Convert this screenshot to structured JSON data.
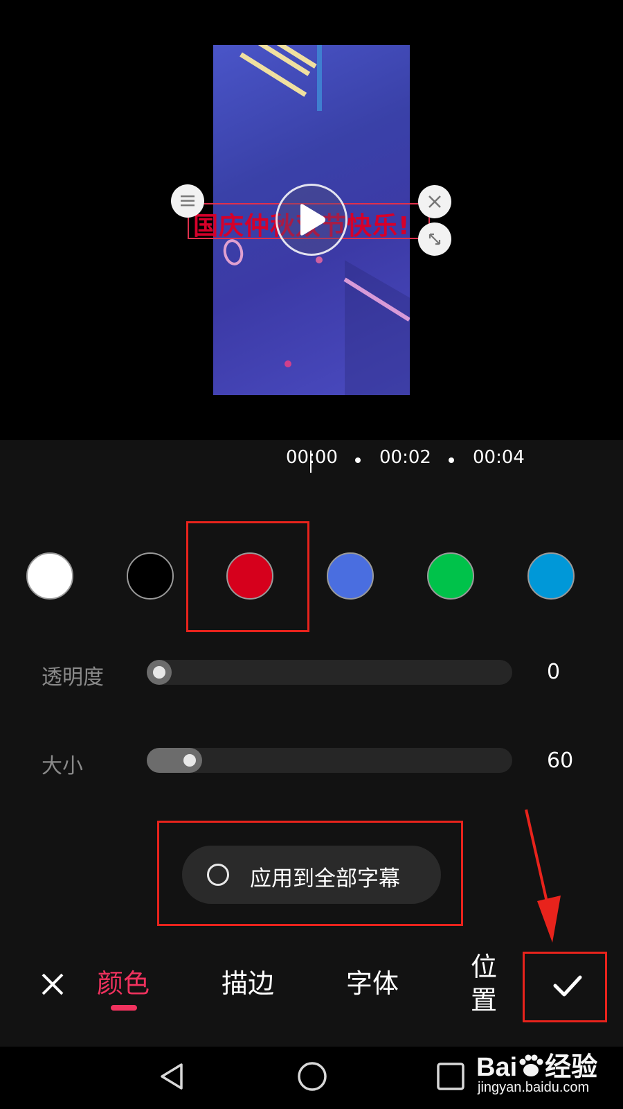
{
  "preview": {
    "subtitle_text": "国庆仲秋双节快乐!"
  },
  "timeline": {
    "current": "00:00",
    "mark_1": "00:02",
    "mark_2": "00:04"
  },
  "colors": {
    "swatches": [
      {
        "name": "white",
        "hex": "#ffffff"
      },
      {
        "name": "black",
        "hex": "#000000"
      },
      {
        "name": "red",
        "hex": "#d6001c",
        "selected": true
      },
      {
        "name": "blue",
        "hex": "#4a6ee0"
      },
      {
        "name": "green",
        "hex": "#00c24a"
      },
      {
        "name": "sky-blue",
        "hex": "#0098d8"
      }
    ]
  },
  "sliders": {
    "opacity": {
      "label": "透明度",
      "value": "0",
      "fraction": 0.0
    },
    "size": {
      "label": "大小",
      "value": "60",
      "fraction": 0.15
    }
  },
  "apply_all": {
    "label": "应用到全部字幕",
    "checked": false
  },
  "tabs": {
    "color": "颜色",
    "stroke": "描边",
    "font": "字体",
    "position_line1": "位",
    "position_line2": "置",
    "active": "color"
  },
  "accent_color": "#f0325e",
  "annotation_color": "#e8231c",
  "watermark": {
    "brand_a": "Bai",
    "brand_b": "经验",
    "url": "jingyan.baidu.com"
  }
}
